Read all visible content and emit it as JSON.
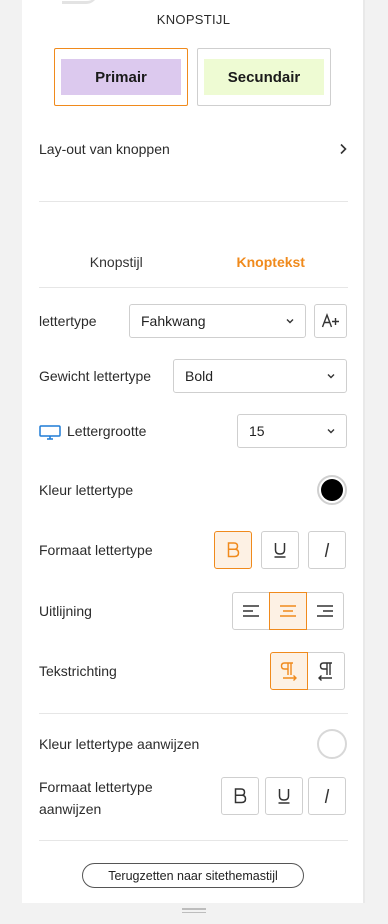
{
  "section_title": "KNOPSTIJL",
  "style_options": [
    {
      "label": "Primair",
      "bg": "#dcc9ee",
      "selected": true
    },
    {
      "label": "Secundair",
      "bg": "#eefbd3",
      "selected": false
    }
  ],
  "layout_link": {
    "label": "Lay-out van knoppen",
    "icon": "chevron-right-icon"
  },
  "tabs": [
    {
      "label": "Knopstijl",
      "active": false
    },
    {
      "label": "Knoptekst",
      "active": true
    }
  ],
  "fields": {
    "font": {
      "label": "lettertype",
      "value": "Fahkwang",
      "extra_icon": "font-size-plus-icon"
    },
    "weight": {
      "label": "Gewicht lettertype",
      "value": "Bold"
    },
    "size": {
      "label": "Lettergrootte",
      "value": "15",
      "icon": "desktop-icon"
    },
    "color": {
      "label": "Kleur lettertype",
      "value": "#000000"
    },
    "format": {
      "label": "Formaat lettertype",
      "buttons": [
        {
          "name": "bold",
          "glyph": "B",
          "active": true
        },
        {
          "name": "underline",
          "glyph": "U",
          "active": false
        },
        {
          "name": "italic",
          "glyph": "I",
          "active": false
        }
      ]
    },
    "alignment": {
      "label": "Uitlijning",
      "options": [
        {
          "name": "left",
          "active": false
        },
        {
          "name": "center",
          "active": true
        },
        {
          "name": "right",
          "active": false
        }
      ]
    },
    "direction": {
      "label": "Tekstrichting",
      "options": [
        {
          "name": "ltr",
          "active": true
        },
        {
          "name": "rtl",
          "active": false
        }
      ]
    },
    "hover_color": {
      "label": "Kleur lettertype aanwijzen",
      "value": "#ffffff"
    },
    "hover_format": {
      "label": "Formaat lettertype aanwijzen",
      "buttons": [
        {
          "name": "bold",
          "glyph": "B",
          "active": false
        },
        {
          "name": "underline",
          "glyph": "U",
          "active": false
        },
        {
          "name": "italic",
          "glyph": "I",
          "active": false
        }
      ]
    }
  },
  "reset_button": "Terugzetten naar sitethemastijl",
  "colors": {
    "accent": "#f08a1c",
    "accent_bg": "#fdf1e4",
    "border": "#cfcfcf"
  }
}
